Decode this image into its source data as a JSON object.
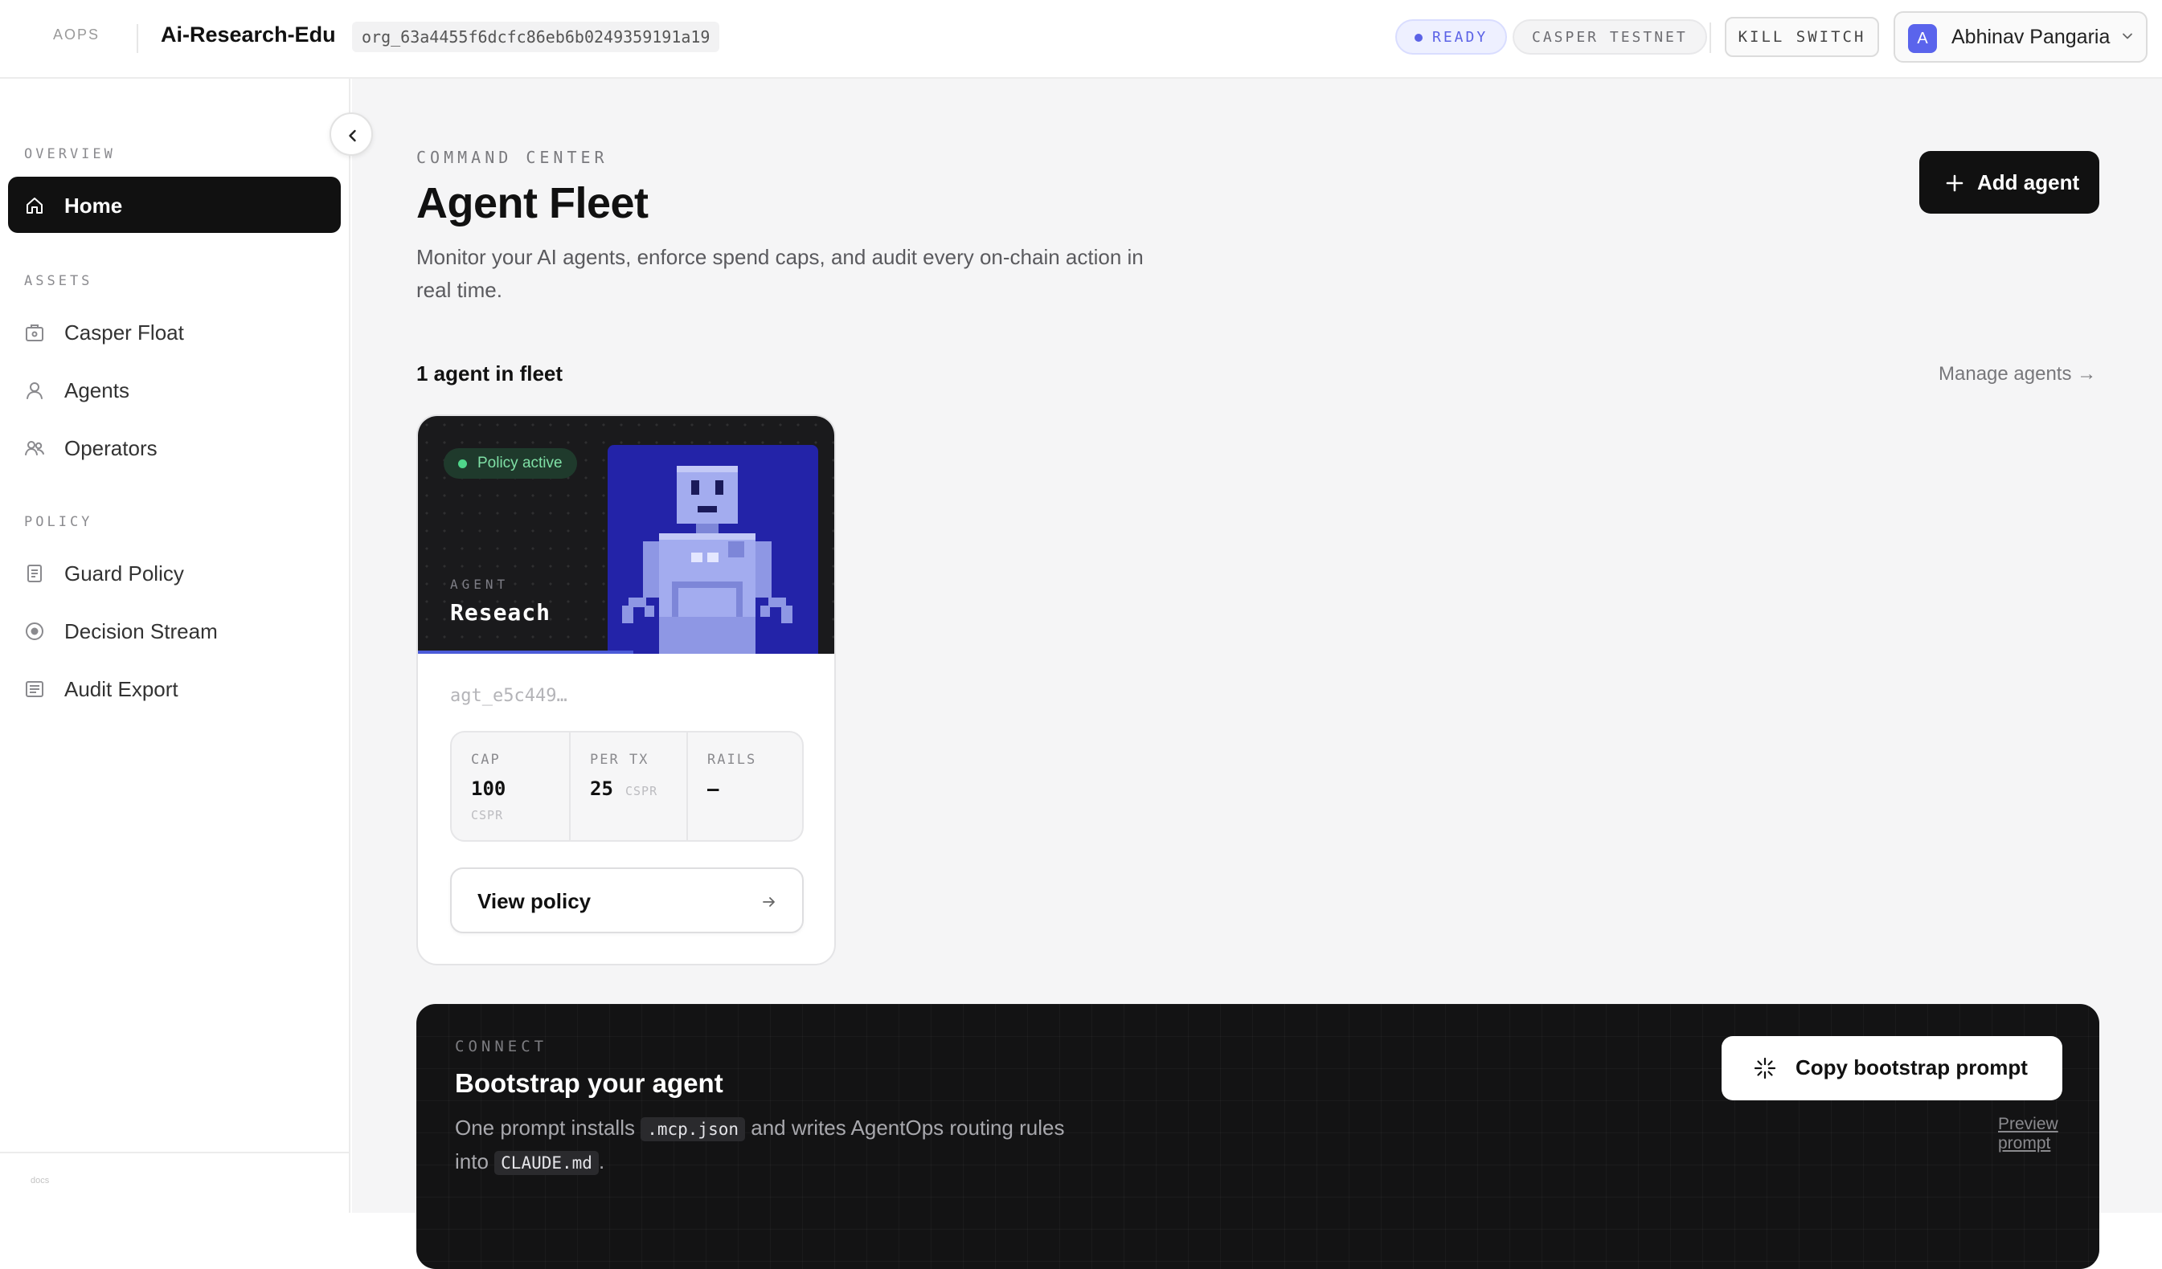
{
  "topbar": {
    "logo": "AOPS",
    "org_name": "Ai-Research-Edu",
    "org_id": "org_63a4455f6dcfc86eb6b0249359191a19",
    "status_pill": "READY",
    "network_pill": "CASPER TESTNET",
    "kill_switch": "KILL SWITCH",
    "user": {
      "initial": "A",
      "name": "Abhinav Pangaria"
    }
  },
  "sidebar": {
    "sections": [
      {
        "label": "OVERVIEW",
        "items": [
          {
            "label": "Home",
            "icon": "home-icon",
            "active": true
          }
        ]
      },
      {
        "label": "ASSETS",
        "items": [
          {
            "label": "Casper Float",
            "icon": "vault-icon"
          },
          {
            "label": "Agents",
            "icon": "user-icon"
          },
          {
            "label": "Operators",
            "icon": "users-icon"
          }
        ]
      },
      {
        "label": "POLICY",
        "items": [
          {
            "label": "Guard Policy",
            "icon": "document-icon"
          },
          {
            "label": "Decision Stream",
            "icon": "target-icon"
          },
          {
            "label": "Audit Export",
            "icon": "list-document-icon"
          }
        ]
      }
    ],
    "footer_text": "docs"
  },
  "main": {
    "eyebrow": "COMMAND CENTER",
    "title": "Agent Fleet",
    "description": "Monitor your AI agents, enforce spend caps, and audit every on-chain action in real time.",
    "add_agent_label": "Add agent",
    "fleet_count": "1 agent in fleet",
    "manage_link": "Manage agents →"
  },
  "agent_card": {
    "badge": "Policy active",
    "eyebrow": "AGENT",
    "name": "Reseach",
    "agent_id": "agt_e5c449…",
    "stats": [
      {
        "key": "CAP",
        "value": "100",
        "unit": "CSPR"
      },
      {
        "key": "PER TX",
        "value": "25",
        "unit": "CSPR"
      },
      {
        "key": "RAILS",
        "value": "—",
        "unit": ""
      }
    ],
    "view_policy_label": "View policy"
  },
  "connect": {
    "eyebrow": "CONNECT",
    "title": "Bootstrap your agent",
    "desc_part1": "One prompt installs",
    "code1": ".mcp.json",
    "desc_part2": "and writes AgentOps routing rules into",
    "code2": "CLAUDE.md",
    "desc_part3": ".",
    "copy_label": "Copy bootstrap prompt",
    "preview_label": "Preview prompt"
  },
  "colors": {
    "accent": "#5b62e6",
    "primary_button": "#111111",
    "robot_background": "#2323a8",
    "robot_body": "#a3acef",
    "policy_green": "#4fd68a"
  }
}
